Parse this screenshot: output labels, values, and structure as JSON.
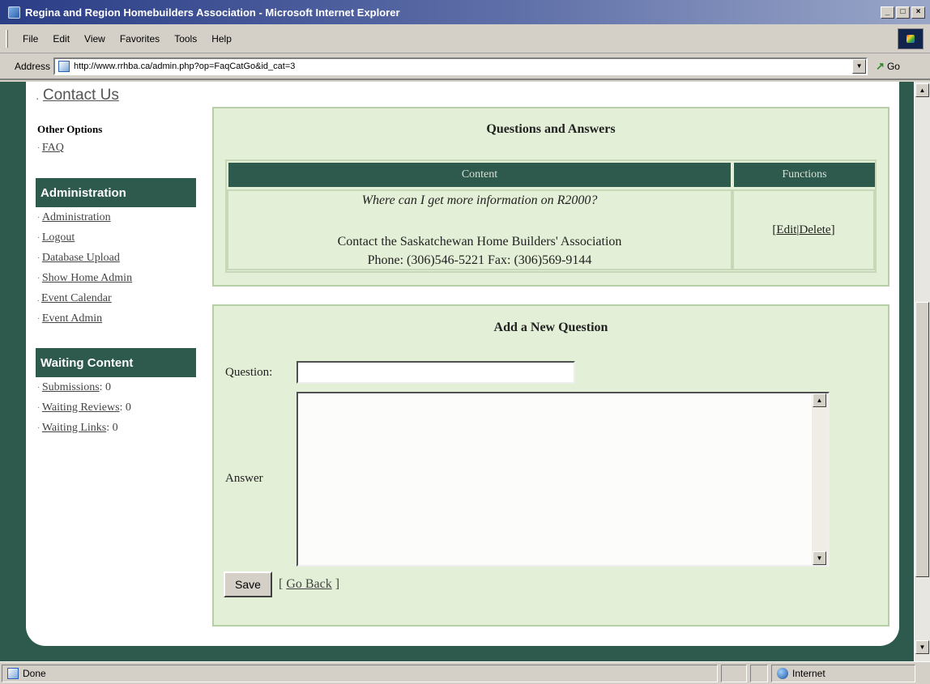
{
  "window": {
    "title": "Regina and Region Homebuilders Association - Microsoft Internet Explorer",
    "controls": [
      "_",
      "□",
      "×"
    ]
  },
  "menu": [
    "File",
    "Edit",
    "View",
    "Favorites",
    "Tools",
    "Help"
  ],
  "address": {
    "label": "Address",
    "url": "http://www.rrhba.ca/admin.php?op=FaqCatGo&id_cat=3",
    "go_label": "Go"
  },
  "sidebar": {
    "contact_link": "Contact Us",
    "other_options": {
      "title": "Other Options",
      "items": [
        "FAQ"
      ]
    },
    "administration": {
      "title": "Administration",
      "items": [
        "Administration",
        "Logout",
        "Database Upload",
        "Show Home Admin",
        "Event Calendar",
        "Event Admin"
      ]
    },
    "waiting_content": {
      "title": "Waiting Content",
      "items": [
        {
          "label": "Submissions",
          "count": ": 0"
        },
        {
          "label": "Waiting Reviews",
          "count": ": 0"
        },
        {
          "label": "Waiting Links",
          "count": ": 0"
        }
      ]
    }
  },
  "qa": {
    "title": "Questions and Answers",
    "columns": [
      "Content",
      "Functions"
    ],
    "rows": [
      {
        "question": "Where can I get more information on R2000?",
        "answer_line1": "Contact the Saskatchewan Home Builders' Association",
        "answer_line2": "Phone: (306)546-5221 Fax: (306)569-9144",
        "functions": {
          "open": "[ ",
          "edit": "Edit",
          "sep": " | ",
          "delete": "Delete",
          "close": " ]"
        }
      }
    ]
  },
  "add_question": {
    "title": "Add a New Question",
    "question_label": "Question:",
    "question_value": "",
    "answer_label": "Answer",
    "answer_value": "",
    "save_label": "Save",
    "go_back": {
      "open": "[ ",
      "label": "Go Back",
      "close": " ]"
    }
  },
  "status": {
    "text": "Done",
    "zone": "Internet"
  },
  "colors": {
    "accent_green": "#2d5a4c",
    "box_bg": "#e3efd6"
  }
}
